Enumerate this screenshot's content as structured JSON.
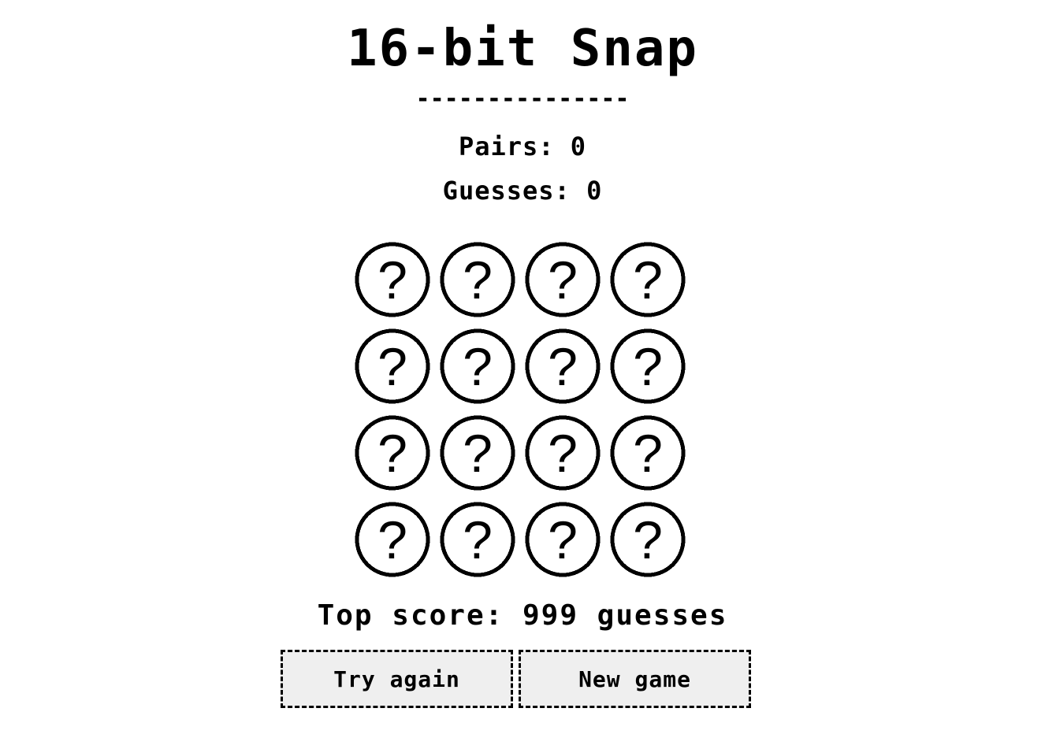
{
  "game": {
    "title": "16-bit Snap",
    "divider": "---------------",
    "pairs_text": "Pairs: 0",
    "guesses_text": "Guesses: 0",
    "top_score_text": "Top score: 999 guesses"
  },
  "board": {
    "rows": 4,
    "columns": 4,
    "cards": [
      {
        "face": "?",
        "icon": "question-mark-icon",
        "state": "hidden"
      },
      {
        "face": "?",
        "icon": "question-mark-icon",
        "state": "hidden"
      },
      {
        "face": "?",
        "icon": "question-mark-icon",
        "state": "hidden"
      },
      {
        "face": "?",
        "icon": "question-mark-icon",
        "state": "hidden"
      },
      {
        "face": "?",
        "icon": "question-mark-icon",
        "state": "hidden"
      },
      {
        "face": "?",
        "icon": "question-mark-icon",
        "state": "hidden"
      },
      {
        "face": "?",
        "icon": "question-mark-icon",
        "state": "hidden"
      },
      {
        "face": "?",
        "icon": "question-mark-icon",
        "state": "hidden"
      },
      {
        "face": "?",
        "icon": "question-mark-icon",
        "state": "hidden"
      },
      {
        "face": "?",
        "icon": "question-mark-icon",
        "state": "hidden"
      },
      {
        "face": "?",
        "icon": "question-mark-icon",
        "state": "hidden"
      },
      {
        "face": "?",
        "icon": "question-mark-icon",
        "state": "hidden"
      },
      {
        "face": "?",
        "icon": "question-mark-icon",
        "state": "hidden"
      },
      {
        "face": "?",
        "icon": "question-mark-icon",
        "state": "hidden"
      },
      {
        "face": "?",
        "icon": "question-mark-icon",
        "state": "hidden"
      },
      {
        "face": "?",
        "icon": "question-mark-icon",
        "state": "hidden"
      }
    ]
  },
  "buttons": {
    "try_again_label": "Try again",
    "new_game_label": "New game"
  },
  "colors": {
    "background": "#ffffff",
    "ink": "#000000",
    "button_bg": "#efefef"
  }
}
